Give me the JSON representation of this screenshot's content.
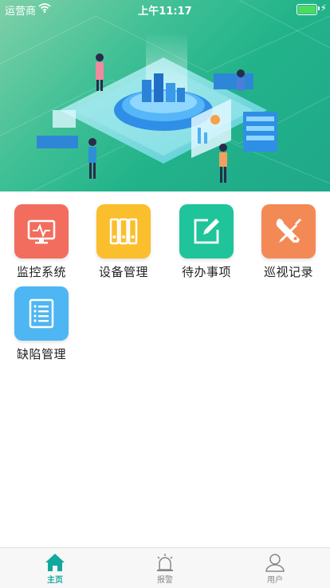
{
  "status_bar": {
    "carrier": "运营商",
    "time": "上午11:17"
  },
  "grid": {
    "items": [
      {
        "label": "监控系统",
        "icon": "monitor-icon",
        "color": "#f26d5e"
      },
      {
        "label": "设备管理",
        "icon": "binders-icon",
        "color": "#fbbe2c"
      },
      {
        "label": "待办事项",
        "icon": "edit-icon",
        "color": "#1fc49a"
      },
      {
        "label": "巡视记录",
        "icon": "tools-icon",
        "color": "#f38a55"
      },
      {
        "label": "缺陷管理",
        "icon": "list-document-icon",
        "color": "#4eb6f2"
      }
    ]
  },
  "tabbar": {
    "items": [
      {
        "label": "主页",
        "icon": "home-icon",
        "active": true
      },
      {
        "label": "报警",
        "icon": "alarm-icon",
        "active": false
      },
      {
        "label": "用户",
        "icon": "user-icon",
        "active": false
      }
    ],
    "active_color": "#13a89e"
  }
}
